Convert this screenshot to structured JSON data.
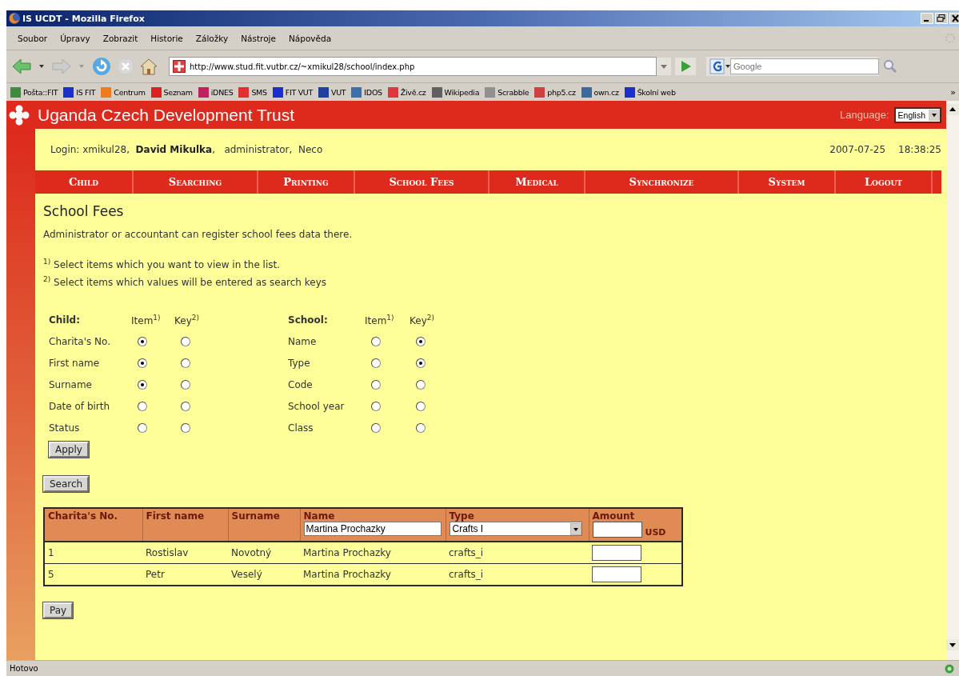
{
  "window": {
    "title": "IS UCDT - Mozilla Firefox"
  },
  "menu_bar": [
    "Soubor",
    "Úpravy",
    "Zobrazit",
    "Historie",
    "Záložky",
    "Nástroje",
    "Nápověda"
  ],
  "address_bar": {
    "url": "http://www.stud.fit.vutbr.cz/~xmikul28/school/index.php"
  },
  "search_bar": {
    "placeholder": "Google"
  },
  "bookmarks": [
    {
      "label": "Pošta::FIT",
      "color": "#3c8c3c"
    },
    {
      "label": "IS FIT",
      "color": "#1a2fd0"
    },
    {
      "label": "Centrum",
      "color": "#f07a20"
    },
    {
      "label": "Seznam",
      "color": "#e02020"
    },
    {
      "label": "iDNES",
      "color": "#c02060"
    },
    {
      "label": "SMS",
      "color": "#e03030"
    },
    {
      "label": "FIT VUT",
      "color": "#1a2fd0"
    },
    {
      "label": "VUT",
      "color": "#2040a0"
    },
    {
      "label": "IDOS",
      "color": "#3a70b0"
    },
    {
      "label": "Živě.cz",
      "color": "#e03838"
    },
    {
      "label": "Wikipedia",
      "color": "#606060"
    },
    {
      "label": "Scrabble",
      "color": "#909090"
    },
    {
      "label": "php5.cz",
      "color": "#d04040"
    },
    {
      "label": "own.cz",
      "color": "#3a6aa0"
    },
    {
      "label": "Školní web",
      "color": "#1a2fd0"
    }
  ],
  "bookmarks_more": "»",
  "page": {
    "site_title": "Uganda Czech Development Trust",
    "language": {
      "label": "Language:",
      "value": "English"
    },
    "login": "Login: xmikul28,  **David Mikulka**,   administrator,  Neco",
    "date": "2007-07-25",
    "time": "18:38:25",
    "nav": [
      "Child",
      "Searching",
      "Printing",
      "School Fees",
      "Medical",
      "Synchronize",
      "System",
      "Logout"
    ],
    "heading": "School Fees",
    "description": "Administrator or accountant can register school fees data there.",
    "notes": [
      "$^{1)}$ Select items which you want to view in the list.",
      "$^{2)}$ Select items which values will be entered as search keys"
    ],
    "selectors": [
      {
        "title": "Child:",
        "item_header": "Item$^{1)}$",
        "key_header": "Key$^{2)}$",
        "rows": [
          {
            "label": "Charita's No.",
            "item_checked": true,
            "key_checked": false
          },
          {
            "label": "First name",
            "item_checked": true,
            "key_checked": false
          },
          {
            "label": "Surname",
            "item_checked": true,
            "key_checked": false
          },
          {
            "label": "Date of birth",
            "item_checked": false,
            "key_checked": false
          },
          {
            "label": "Status",
            "item_checked": false,
            "key_checked": false
          }
        ]
      },
      {
        "title": "School:",
        "item_header": "Item$^{1)}$",
        "key_header": "Key$^{2)}$",
        "rows": [
          {
            "label": "Name",
            "item_checked": false,
            "key_checked": true
          },
          {
            "label": "Type",
            "item_checked": false,
            "key_checked": true
          },
          {
            "label": "Code",
            "item_checked": false,
            "key_checked": false
          },
          {
            "label": "School year",
            "item_checked": false,
            "key_checked": false
          },
          {
            "label": "Class",
            "item_checked": false,
            "key_checked": false
          }
        ]
      }
    ],
    "apply_button": "Apply",
    "search_button": "Search",
    "pay_button": "Pay",
    "table": {
      "columns": [
        {
          "label": "Charita's No.",
          "kind": "plain"
        },
        {
          "label": "First name",
          "kind": "plain"
        },
        {
          "label": "Surname",
          "kind": "plain"
        },
        {
          "label": "Name",
          "kind": "text",
          "value": "Martina Prochazky"
        },
        {
          "label": "Type",
          "kind": "select",
          "value": "Crafts I"
        },
        {
          "label": "Amount",
          "kind": "amount",
          "unit": "USD"
        }
      ],
      "rows": [
        {
          "cells": [
            "1",
            "Rostislav",
            "Novotný",
            "Martina Prochazky",
            "crafts_i"
          ]
        },
        {
          "cells": [
            "5",
            "Petr",
            "Veselý",
            "Martina Prochazky",
            "crafts_i"
          ]
        }
      ]
    }
  },
  "status_bar": {
    "text": "Hotovo"
  }
}
